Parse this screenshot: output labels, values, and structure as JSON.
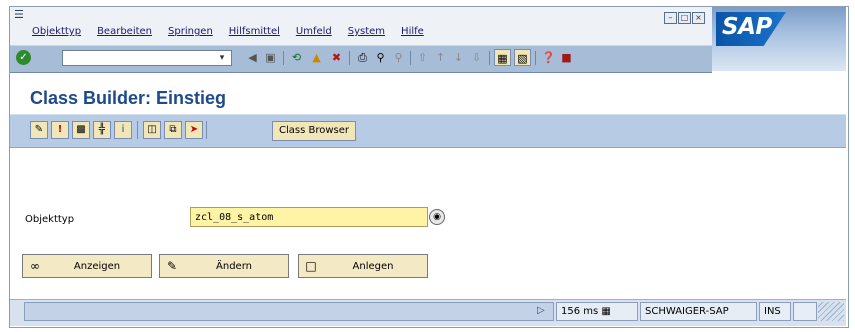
{
  "menubar": {
    "items": [
      "Objekttyp",
      "Bearbeiten",
      "Springen",
      "Hilfsmittel",
      "Umfeld",
      "System",
      "Hilfe"
    ]
  },
  "logo": {
    "text": "SAP"
  },
  "toolbar": {
    "command_field_value": ""
  },
  "title": "Class Builder: Einstieg",
  "app_toolbar": {
    "class_browser_label": "Class Browser"
  },
  "form": {
    "objekttyp_label": "Objekttyp",
    "objekttyp_value": "zcl_08_s_atom"
  },
  "actions": {
    "anzeigen_label": "Anzeigen",
    "aendern_label": "Ändern",
    "anlegen_label": "Anlegen"
  },
  "statusbar": {
    "response_time": "156 ms",
    "system": "SCHWAIGER-SAP",
    "mode": "INS"
  },
  "colors": {
    "title": "#1c4a8c",
    "toolbar_bg": "#a7bcd7",
    "app_toolbar_bg": "#b7cbe5",
    "input_bg": "#fff4a6",
    "button_bg": "#f3e9c4"
  }
}
